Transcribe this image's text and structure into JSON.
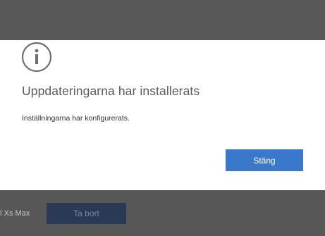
{
  "dialog": {
    "icon": "info-icon",
    "title": "Uppdateringarna har installerats",
    "message": "Inställningarna har konfigurerats.",
    "close_label": "Stäng"
  },
  "background": {
    "device_name": "el Xs Max",
    "remove_label": "Ta bort"
  },
  "colors": {
    "overlay": "#585858",
    "primary_button": "#3a78cc",
    "dimmed_button": "#2a3a55"
  }
}
